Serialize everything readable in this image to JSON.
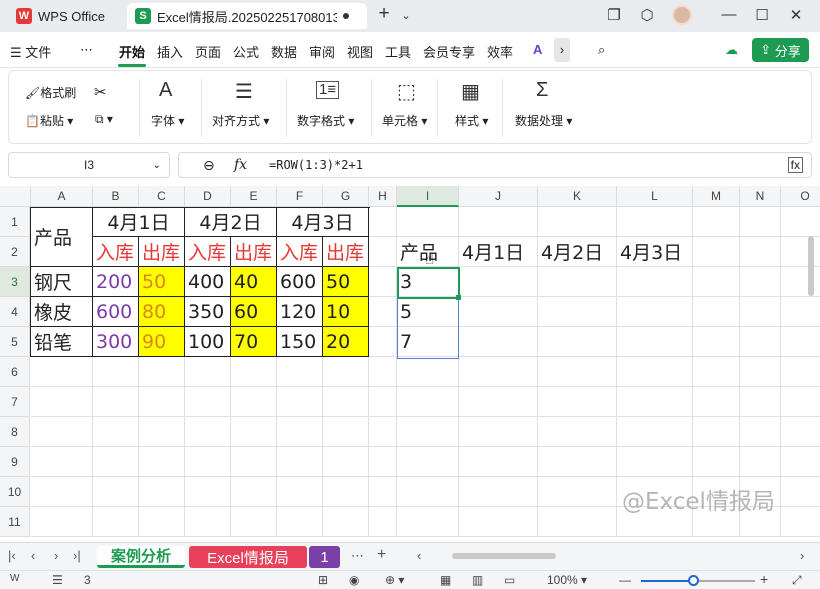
{
  "titlebar": {
    "app_tab": "WPS Office",
    "doc_tab": "Excel情报局.20250225170801З",
    "icons": [
      "wps-logo",
      "sheet-logo",
      "new-tab",
      "tab-list",
      "window-panel",
      "cube",
      "avatar",
      "minimize",
      "maximize",
      "close"
    ]
  },
  "menubar": {
    "file": "文件",
    "more": "⋯",
    "tabs": [
      "开始",
      "插入",
      "页面",
      "公式",
      "数据",
      "审阅",
      "视图",
      "工具",
      "会员专享",
      "效率"
    ],
    "active": "开始",
    "share": "分享"
  },
  "ribbon": {
    "format_painter": "格式刷",
    "paste": "粘贴",
    "font": "字体",
    "align": "对齐方式",
    "number_format": "数字格式",
    "cell": "单元格",
    "style": "样式",
    "data_proc": "数据处理"
  },
  "formula_bar": {
    "name_box": "I3",
    "fx": "fx",
    "formula": "=ROW(1:3)*2+1"
  },
  "grid": {
    "columns": [
      "A",
      "B",
      "C",
      "D",
      "E",
      "F",
      "G",
      "H",
      "I",
      "J",
      "K",
      "L",
      "M",
      "N",
      "O"
    ],
    "rows": [
      "1",
      "2",
      "3",
      "4",
      "5",
      "6",
      "7",
      "8",
      "9",
      "10",
      "11"
    ],
    "selected_col": "I",
    "selected_row": "3",
    "cells": {
      "A1": "产品",
      "B1": "4月1日",
      "D1": "4月2日",
      "F1": "4月3日",
      "B2": "入库",
      "C2": "出库",
      "D2": "入库",
      "E2": "出库",
      "F2": "入库",
      "G2": "出库",
      "A3": "钢尺",
      "B3": "200",
      "C3": "50",
      "D3": "400",
      "E3": "40",
      "F3": "600",
      "G3": "50",
      "A4": "橡皮",
      "B4": "600",
      "C4": "80",
      "D4": "350",
      "E4": "60",
      "F4": "120",
      "G4": "10",
      "A5": "铅笔",
      "B5": "300",
      "C5": "90",
      "D5": "100",
      "E5": "70",
      "F5": "150",
      "G5": "20",
      "I2": "产品",
      "J2": "4月1日",
      "K2": "4月2日",
      "L2": "4月3日",
      "I3": "3",
      "I4": "5",
      "I5": "7"
    },
    "colors": {
      "yellow": "#ffff00",
      "red": "#e53935",
      "purple": "#7a3ea8",
      "orange": "#d88a16",
      "accent": "#1e9b52"
    }
  },
  "watermark": "@Excel情报局",
  "sheet_tabs": {
    "tabs": [
      "案例分析",
      "Excel情报局",
      "1"
    ],
    "more": "⋯",
    "add": "+"
  },
  "status": {
    "count": "3",
    "zoom": "100%"
  }
}
